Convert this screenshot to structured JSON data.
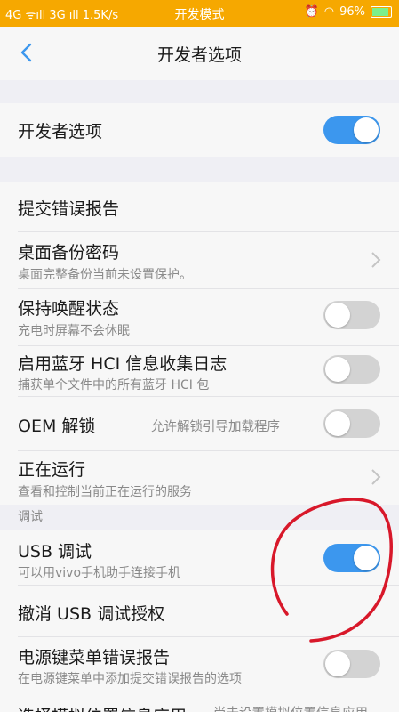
{
  "status_bar": {
    "signal_left": "4G ᯤıll 3G ıll 1.5K/s",
    "mode": "开发模式",
    "battery_pct": "96%"
  },
  "header": {
    "title": "开发者选项"
  },
  "rows": {
    "dev_options": {
      "label": "开发者选项",
      "toggle": true
    },
    "bug_report": {
      "label": "提交错误报告"
    },
    "backup_pw": {
      "label": "桌面备份密码",
      "sub": "桌面完整备份当前未设置保护。"
    },
    "stay_awake": {
      "label": "保持唤醒状态",
      "sub": "充电时屏幕不会休眠",
      "toggle": false
    },
    "bt_hci": {
      "label": "启用蓝牙 HCI 信息收集日志",
      "sub": "捕获单个文件中的所有蓝牙 HCI 包",
      "toggle": false
    },
    "oem_unlock": {
      "label": "OEM 解锁",
      "hint": "允许解锁引导加载程序",
      "toggle": false
    },
    "running": {
      "label": "正在运行",
      "sub": "查看和控制当前正在运行的服务"
    },
    "debug_section": "调试",
    "usb_debug": {
      "label": "USB 调试",
      "sub": "可以用vivo手机助手连接手机",
      "toggle": true
    },
    "revoke_usb": {
      "label": "撤消 USB 调试授权"
    },
    "power_bug": {
      "label": "电源键菜单错误报告",
      "sub": "在电源键菜单中添加提交错误报告的选项",
      "toggle": false
    },
    "mock_loc": {
      "label": "选择模拟位置信息应用",
      "hint": "尚未设置模拟位置信息应用"
    }
  },
  "colors": {
    "status_bar": "#f6a800",
    "accent": "#3c97ee",
    "annotation": "#d8182a"
  }
}
